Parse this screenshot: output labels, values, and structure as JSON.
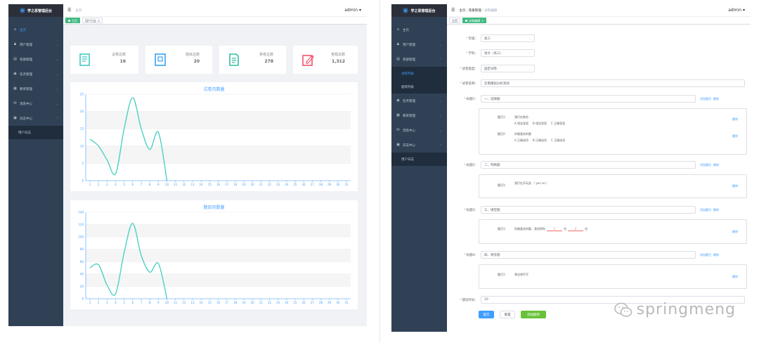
{
  "left": {
    "logo": "学之思管理后台",
    "menu": [
      "主页",
      "用户管理",
      "卷册管理",
      "任务管理",
      "教育管理",
      "消息中心",
      "日志中心"
    ],
    "submenu": [
      "用户日志"
    ],
    "navbar": {
      "crumb": "主页",
      "user": "admin"
    },
    "tags": [
      "主页",
      "用户日志"
    ],
    "stats": [
      {
        "label": "试卷总数",
        "value": "16",
        "icon": "exam-paper-icon",
        "color": "#40c9c6"
      },
      {
        "label": "题目总数",
        "value": "20",
        "icon": "question-icon",
        "color": "#36a3f7"
      },
      {
        "label": "答卷总数",
        "value": "278",
        "icon": "answer-sheet-icon",
        "color": "#34bfa3"
      },
      {
        "label": "答题总数",
        "value": "1,312",
        "icon": "edit-icon",
        "color": "#f4516c"
      }
    ],
    "chart1_title": "试卷月数量",
    "chart2_title": "题目月数量"
  },
  "chart_data": [
    {
      "type": "line",
      "title": "试卷月数量",
      "x": [
        1,
        2,
        3,
        4,
        5,
        6,
        7,
        8,
        9,
        10,
        11,
        12,
        13,
        14,
        15,
        16,
        17,
        18,
        19,
        20,
        21,
        22,
        23,
        24,
        25,
        26,
        27,
        28,
        29,
        30,
        31
      ],
      "series": [
        {
          "values": [
            12,
            10,
            6,
            2,
            15,
            24,
            15,
            9,
            14,
            0
          ]
        }
      ],
      "ylim": [
        0,
        25
      ],
      "yticks": [
        0,
        5,
        10,
        15,
        20,
        25
      ],
      "color": "#4fd1c5"
    },
    {
      "type": "line",
      "title": "题目月数量",
      "x": [
        1,
        2,
        3,
        4,
        5,
        6,
        7,
        8,
        9,
        10,
        11,
        12,
        13,
        14,
        15,
        16,
        17,
        18,
        19,
        20,
        21,
        22,
        23,
        24,
        25,
        26,
        27,
        28,
        29,
        30,
        31
      ],
      "series": [
        {
          "values": [
            50,
            55,
            22,
            8,
            75,
            122,
            70,
            43,
            57,
            0
          ]
        }
      ],
      "ylim": [
        0,
        140
      ],
      "yticks": [
        0,
        20,
        40,
        60,
        80,
        100,
        120,
        140
      ],
      "color": "#4fd1c5"
    }
  ],
  "right": {
    "logo": "学之思管理后台",
    "menu": [
      "主页",
      "用户管理",
      "卷册管理",
      "任务管理",
      "教育管理",
      "消息中心",
      "日志中心"
    ],
    "exam_submenu": [
      "试卷列表",
      "题目列表"
    ],
    "log_submenu": [
      "用户日志"
    ],
    "navbar": {
      "crumb1": "主页",
      "crumb2": "卷册管理",
      "crumb3": "试卷编辑",
      "user": "admin"
    },
    "tags": [
      "主页",
      "试卷编辑"
    ],
    "form": {
      "grade_label": "年级：",
      "grade_value": "高三",
      "subject_label": "学科：",
      "subject_value": "语文（高三）",
      "type_label": "试卷类型：",
      "type_value": "固定试卷",
      "name_label": "试卷名称：",
      "name_value": "云南模拟分析测试",
      "q1_label": "标题1：",
      "q1_value": "一、选择题",
      "q2_label": "标题2：",
      "q2_value": "二、判断题",
      "q3_label": "标题3：",
      "q3_value": "三、填空题",
      "q4_label": "标题4：",
      "q4_value": "四、简答题",
      "add_link": "添加题目",
      "del_link": "删除",
      "remove": "删除",
      "q1a_label": "题目1：",
      "q1a_text": "我们在做些",
      "q1a_opts": [
        "A  错误答案",
        "B  错误答案",
        "C  正确答案"
      ],
      "q1b_label": "题目2：",
      "q1b_text": "你最喜欢的题",
      "q1b_opts": [
        "A  正确选项",
        "B  正确选项",
        "C  正确选项"
      ],
      "q2a_label": "题目1：",
      "q2a_text": "我们在开玩笑  （ yes  no ）",
      "q3a_label": "题目1：",
      "q3a_pre": "你最喜欢的题，我觉得你",
      "q3a_b1": "1",
      "q3a_mid": "也",
      "q3a_b2": "2",
      "q3a_post": "也",
      "q4a_label": "题目1：",
      "q4a_text": "我也想写写",
      "time_label": "建议时长：",
      "time_value": "10",
      "submit": "提交",
      "reset": "重置",
      "add_exam": "添加题目"
    }
  },
  "watermark": "springmeng"
}
